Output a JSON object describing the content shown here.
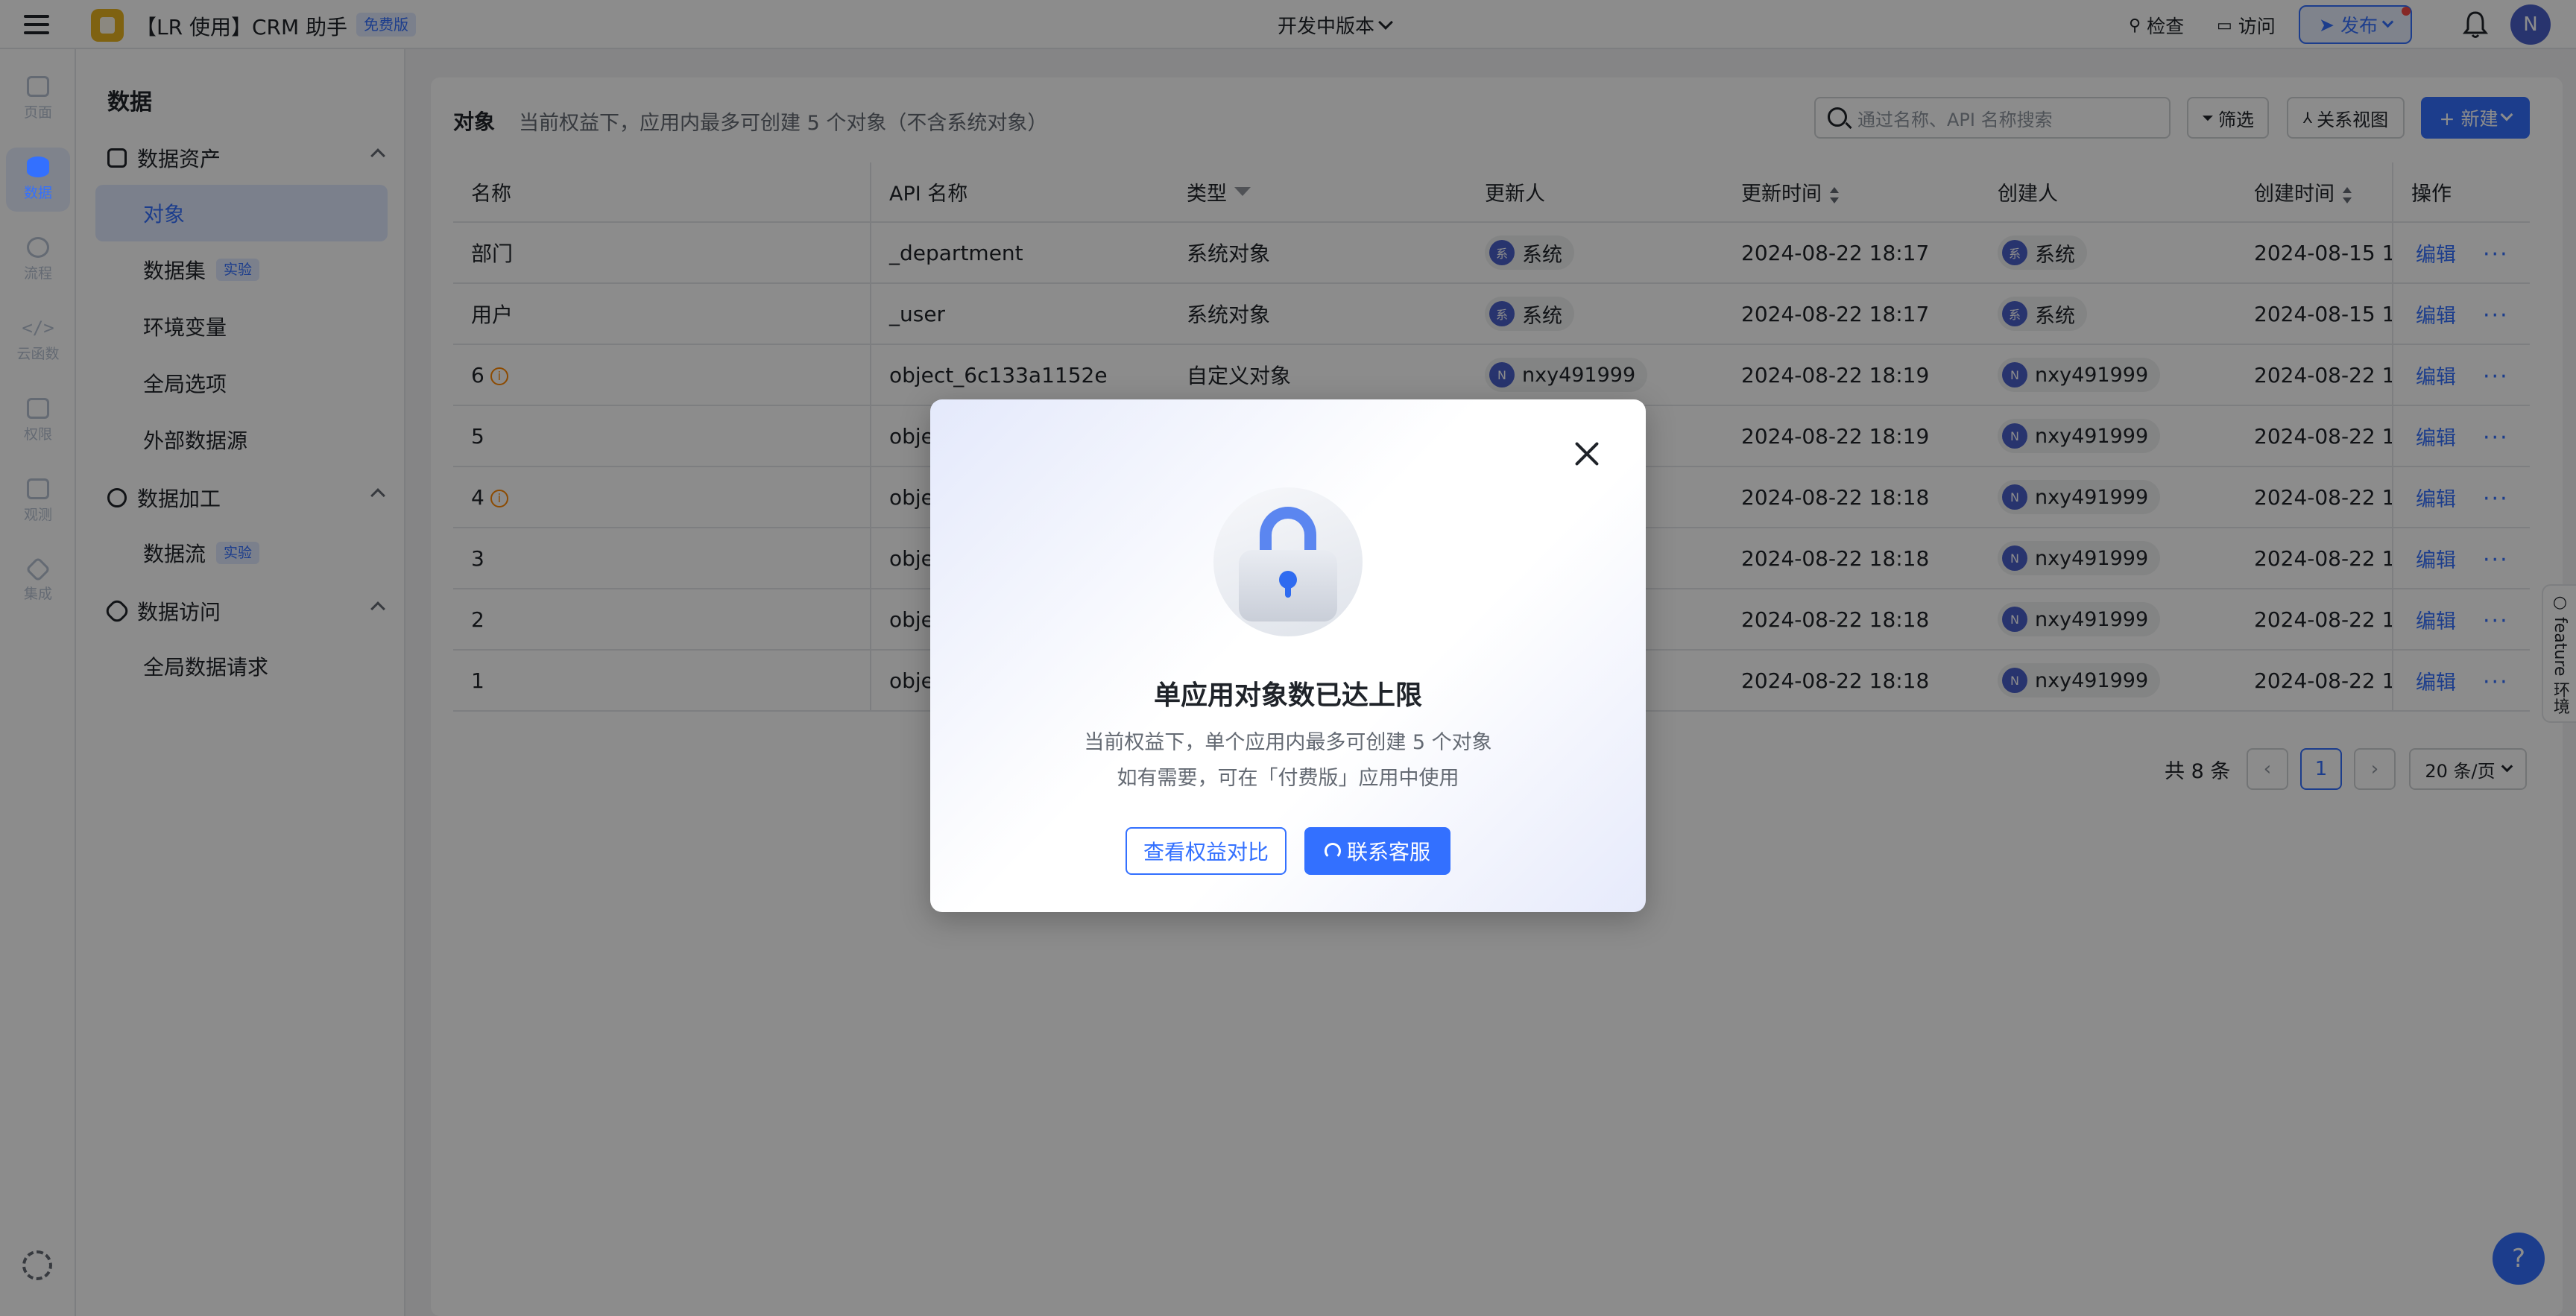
{
  "topbar": {
    "app_title": "【LR 使用】CRM 助手",
    "plan_badge": "免费版",
    "version": "开发中版本",
    "check": "检查",
    "visit": "访问",
    "publish": "发布",
    "user_initial": "N"
  },
  "rail": {
    "items": [
      {
        "label": "页面",
        "icon": "page-icon"
      },
      {
        "label": "数据",
        "icon": "database-icon"
      },
      {
        "label": "流程",
        "icon": "flow-icon"
      },
      {
        "label": "云函数",
        "icon": "code-icon"
      },
      {
        "label": "权限",
        "icon": "lock-icon"
      },
      {
        "label": "观测",
        "icon": "monitor-icon"
      },
      {
        "label": "集成",
        "icon": "cube-icon"
      }
    ],
    "active_index": 1
  },
  "sidebar": {
    "title": "数据",
    "groups": [
      {
        "label": "数据资产",
        "items": [
          {
            "label": "对象",
            "badge": ""
          },
          {
            "label": "数据集",
            "badge": "实验"
          },
          {
            "label": "环境变量",
            "badge": ""
          },
          {
            "label": "全局选项",
            "badge": ""
          },
          {
            "label": "外部数据源",
            "badge": ""
          }
        ]
      },
      {
        "label": "数据加工",
        "items": [
          {
            "label": "数据流",
            "badge": "实验"
          }
        ]
      },
      {
        "label": "数据访问",
        "items": [
          {
            "label": "全局数据请求",
            "badge": ""
          }
        ]
      }
    ]
  },
  "main": {
    "title": "对象",
    "description": "当前权益下，应用内最多可创建 5 个对象（不含系统对象）",
    "search_placeholder": "通过名称、API 名称搜索",
    "filter_label": "筛选",
    "relation_view_label": "关系视图",
    "new_label": "+ 新建",
    "columns": [
      "名称",
      "API 名称",
      "类型",
      "更新人",
      "更新时间",
      "创建人",
      "创建时间",
      "操作"
    ],
    "rows": [
      {
        "name": "部门",
        "warn": false,
        "api": "_department",
        "type": "系统对象",
        "updater": "系统",
        "updated": "2024-08-22 18:17",
        "creator": "系统",
        "created": "2024-08-15 1"
      },
      {
        "name": "用户",
        "warn": false,
        "api": "_user",
        "type": "系统对象",
        "updater": "系统",
        "updated": "2024-08-22 18:17",
        "creator": "系统",
        "created": "2024-08-15 1"
      },
      {
        "name": "6",
        "warn": true,
        "api": "object_6c133a1152e",
        "type": "自定义对象",
        "updater": "nxy491999",
        "updated": "2024-08-22 18:19",
        "creator": "nxy491999",
        "created": "2024-08-22 1"
      },
      {
        "name": "5",
        "warn": false,
        "api": "obje",
        "type": "",
        "updater": "",
        "updated": "2024-08-22 18:19",
        "creator": "nxy491999",
        "created": "2024-08-22 1"
      },
      {
        "name": "4",
        "warn": true,
        "api": "obje",
        "type": "",
        "updater": "",
        "updated": "2024-08-22 18:18",
        "creator": "nxy491999",
        "created": "2024-08-22 1"
      },
      {
        "name": "3",
        "warn": false,
        "api": "obje",
        "type": "",
        "updater": "",
        "updated": "2024-08-22 18:18",
        "creator": "nxy491999",
        "created": "2024-08-22 1"
      },
      {
        "name": "2",
        "warn": false,
        "api": "obje",
        "type": "",
        "updater": "",
        "updated": "2024-08-22 18:18",
        "creator": "nxy491999",
        "created": "2024-08-22 1"
      },
      {
        "name": "1",
        "warn": false,
        "api": "obje",
        "type": "",
        "updater": "",
        "updated": "2024-08-22 18:18",
        "creator": "nxy491999",
        "created": "2024-08-22 1"
      }
    ],
    "edit_label": "编辑",
    "more_label": "···",
    "system_avatar": "系",
    "user_avatar": "N",
    "pager": {
      "total": "共 8 条",
      "current_page": "1",
      "page_size": "20 条/页"
    }
  },
  "feature_tab": "○ feature 环境",
  "help": "?",
  "modal": {
    "title": "单应用对象数已达上限",
    "line1": "当前权益下，单个应用内最多可创建 5 个对象",
    "line2": "如有需要，可在「付费版」应用中使用",
    "secondary_button": "查看权益对比",
    "primary_button": "联系客服"
  },
  "colors": {
    "accent": "#3370ff",
    "warning": "#ff8800",
    "overlay": "rgba(0,0,0,0.45)"
  }
}
